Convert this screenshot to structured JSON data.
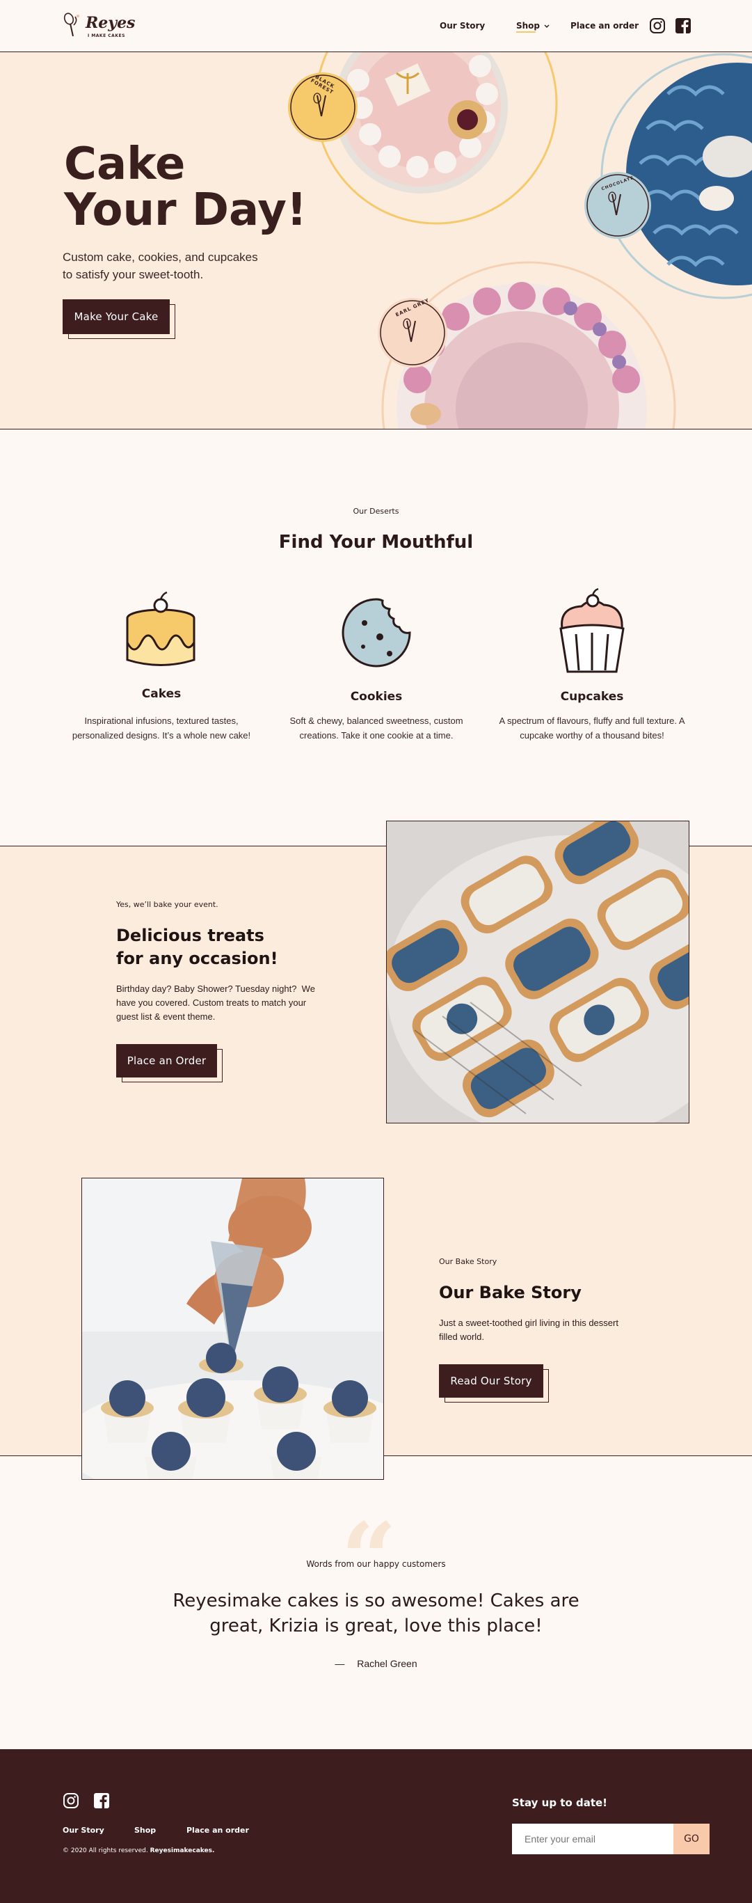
{
  "header": {
    "logo_script": "Reyes",
    "logo_tagline": "I MAKE CAKES",
    "nav": {
      "our_story": "Our Story",
      "shop": "Shop",
      "place_order": "Place an order"
    },
    "icons": [
      "instagram-icon",
      "facebook-icon"
    ]
  },
  "hero": {
    "title_line1": "Cake",
    "title_line2": "Your Day!",
    "subtitle_line1": "Custom cake, cookies, and cupcakes",
    "subtitle_line2": "to satisfy your sweet-tooth.",
    "cta": "Make Your Cake",
    "badges": {
      "black_forest": "BLACK FOREST",
      "chocolate": "CHOCOLATE",
      "earl_grey": "EARL GREY"
    }
  },
  "deserts": {
    "eyebrow": "Our Deserts",
    "title": "Find Your Mouthful",
    "cards": [
      {
        "icon": "cake-icon",
        "title": "Cakes",
        "line1": "Inspirational infusions, textured tastes,",
        "line2": "personalized designs. It’s a whole new cake!"
      },
      {
        "icon": "cookie-icon",
        "title": "Cookies",
        "line1": "Soft & chewy, balanced sweetness, custom",
        "line2": "creations. Take it one cookie at a time."
      },
      {
        "icon": "cupcake-icon",
        "title": "Cupcakes",
        "line1": "A spectrum of flavours, fluffy and full texture. A",
        "line2": "cupcake worthy of a thousand bites!"
      }
    ]
  },
  "occasion": {
    "eyebrow": "Yes, we’ll bake your event.",
    "title_line1": "Delicious treats",
    "title_line2": "for any occasion!",
    "body_line1": "Birthday day? Baby Shower? Tuesday night?  We",
    "body_line2": "have you covered. Custom treats to match your",
    "body_line3": "guest list & event theme.",
    "cta": "Place an Order"
  },
  "story": {
    "eyebrow": "Our Bake Story",
    "title": "Our Bake Story",
    "body_line1": "Just a sweet-toothed girl living in this dessert",
    "body_line2": "filled world.",
    "cta": "Read Our Story"
  },
  "testimonial": {
    "eyebrow": "Words from our happy customers",
    "quote_line1": "Reyesimake cakes is so awesome! Cakes are",
    "quote_line2": "great, Krizia is great, love this place!",
    "dash": "—",
    "author": "Rachel Green"
  },
  "footer": {
    "links": {
      "our_story": "Our Story",
      "shop": "Shop",
      "place_order": "Place an order"
    },
    "copyright": "© 2020 All rights reserved.",
    "copyright_brand": "Reyesimakecakes.",
    "newsletter_title": "Stay up to date!",
    "email_placeholder": "Enter your email",
    "go": "GO"
  },
  "colors": {
    "brand_dark": "#3e1d1f",
    "cream": "#fcecde",
    "background": "#fdf8f3",
    "accent_yellow": "#f6c96a",
    "accent_blue": "#b7cfd6",
    "accent_pink": "#f4b8a5"
  }
}
